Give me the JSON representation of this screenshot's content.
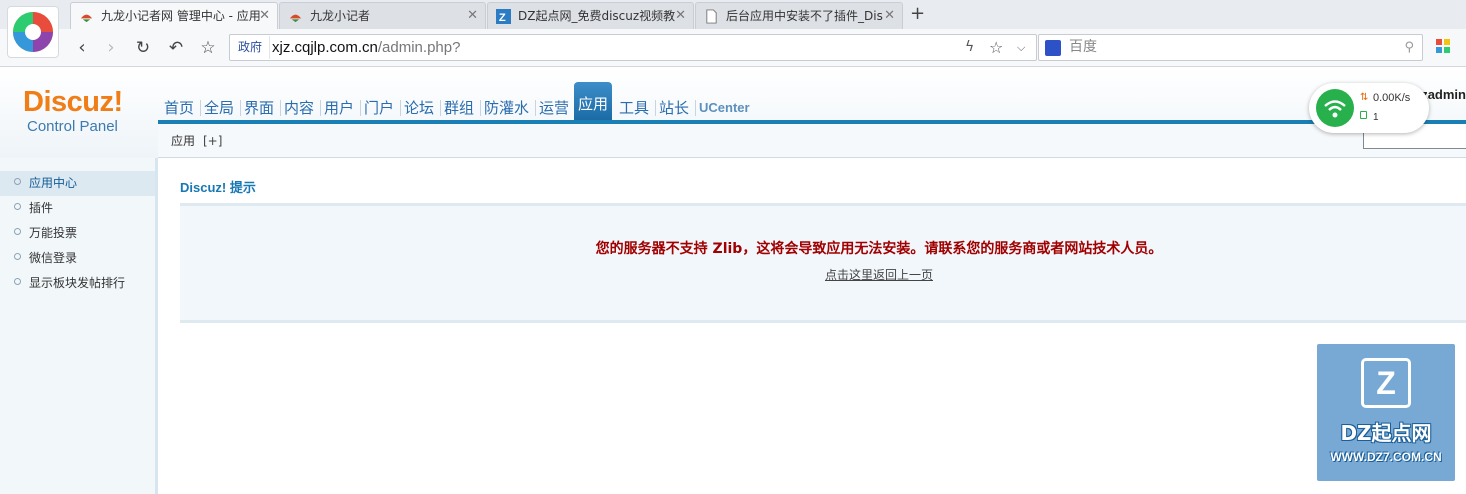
{
  "browser": {
    "tabs": [
      {
        "title": "九龙小记者网 管理中心 - 应用",
        "icon": "discuz-favicon",
        "active": true
      },
      {
        "title": "九龙小记者",
        "icon": "discuz-favicon",
        "active": false
      },
      {
        "title": "DZ起点网_免费discuz视频教",
        "icon": "dz7-favicon",
        "active": false
      },
      {
        "title": "后台应用中安装不了插件_Dis",
        "icon": "page-icon",
        "active": false
      }
    ],
    "address": {
      "badge": "政府",
      "host": "xjz.cqjlp.com.cn",
      "path": "/admin.php?"
    },
    "search": {
      "placeholder": "百度"
    }
  },
  "discuz": {
    "logo": {
      "word": "Discuz!",
      "sub": "Control Panel"
    },
    "nav": [
      "首页",
      "全局",
      "界面",
      "内容",
      "用户",
      "门户",
      "论坛",
      "群组",
      "防灌水",
      "运营",
      "应用",
      "工具",
      "站长",
      "UCenter"
    ],
    "nav_active": "应用",
    "user": "zadmin",
    "subbar": {
      "label": "应用",
      "add": "[+]"
    },
    "sidebar": [
      {
        "label": "应用中心",
        "active": true
      },
      {
        "label": "插件",
        "active": false
      },
      {
        "label": "万能投票",
        "active": false
      },
      {
        "label": "微信登录",
        "active": false
      },
      {
        "label": "显示板块发帖排行",
        "active": false
      }
    ],
    "main": {
      "title": "Discuz! 提示",
      "message": "您的服务器不支持 Zlib，这将会导致应用无法安装。请联系您的服务商或者网站技术人员。",
      "back_link": "点击这里返回上一页"
    }
  },
  "net_widget": {
    "speed": "0.00K/s",
    "count": "1"
  },
  "watermark": {
    "logo": "Z",
    "name": "DZ起点网",
    "url": "WWW.DZ7.COM.CN"
  },
  "colors": {
    "accent": "#1a7fb4",
    "logo_orange": "#f07d16",
    "error": "#a00000"
  }
}
